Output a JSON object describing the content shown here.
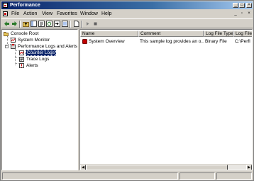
{
  "window": {
    "title": "Performance"
  },
  "menu": {
    "items": [
      {
        "label": "File"
      },
      {
        "label": "Action"
      },
      {
        "label": "View"
      },
      {
        "label": "Favorites"
      },
      {
        "label": "Window"
      },
      {
        "label": "Help"
      }
    ]
  },
  "title_buttons": {
    "minimize": "_",
    "maximize": "□",
    "close": "×"
  },
  "mdi_buttons": {
    "minimize": "_",
    "restore": "▫",
    "close": "×"
  },
  "tree": {
    "items": [
      {
        "label": "Console Root"
      },
      {
        "label": "System Monitor"
      },
      {
        "label": "Performance Logs and Alerts",
        "expander": "−"
      },
      {
        "label": "Counter Logs"
      },
      {
        "label": "Trace Logs"
      },
      {
        "label": "Alerts"
      }
    ]
  },
  "list": {
    "columns": [
      {
        "label": "Name"
      },
      {
        "label": "Comment"
      },
      {
        "label": "Log File Type"
      },
      {
        "label": "Log File"
      }
    ],
    "rows": [
      {
        "name": "System Overview",
        "comment": "This sample log provides an o...",
        "type": "Binary File",
        "file": "C:\\Perfl"
      }
    ]
  },
  "scrollbar": {
    "left": "◀",
    "right": "▶"
  },
  "colors": {
    "title_start": "#0a246a",
    "title_end": "#a6caf0",
    "selection": "#0a246a",
    "face": "#d4d0c8"
  }
}
